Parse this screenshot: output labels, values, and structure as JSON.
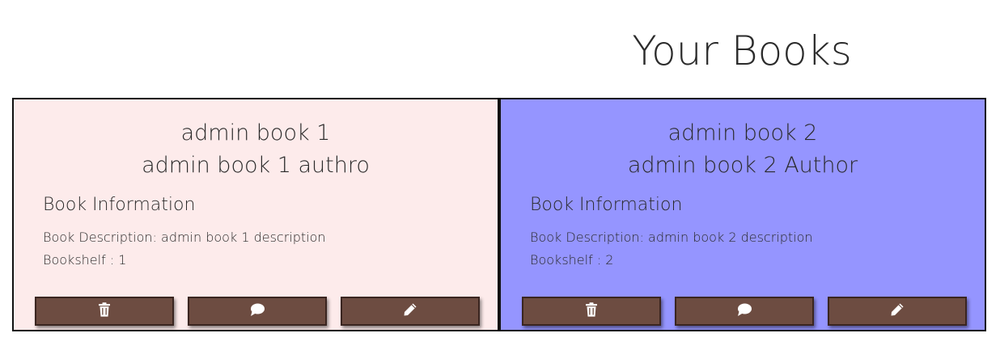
{
  "page_title": "Your Books",
  "books": [
    {
      "title": "admin book 1",
      "author": "admin book 1 authro",
      "info_heading": "Book Information",
      "description": "Book Description: admin book 1 description",
      "bookshelf": "Bookshelf : 1",
      "background": "#fdebeb",
      "actions": [
        {
          "icon": "trash-icon"
        },
        {
          "icon": "comment-icon"
        },
        {
          "icon": "pencil-icon"
        }
      ]
    },
    {
      "title": "admin book 2",
      "author": "admin book 2 Author",
      "info_heading": "Book Information",
      "description": "Book Description: admin book 2 description",
      "bookshelf": "Bookshelf : 2",
      "background": "#9595ff",
      "actions": [
        {
          "icon": "trash-icon"
        },
        {
          "icon": "comment-icon"
        },
        {
          "icon": "pencil-icon"
        }
      ]
    }
  ],
  "colors": {
    "button_bg": "#6d4c41",
    "button_border": "#3a2520"
  }
}
